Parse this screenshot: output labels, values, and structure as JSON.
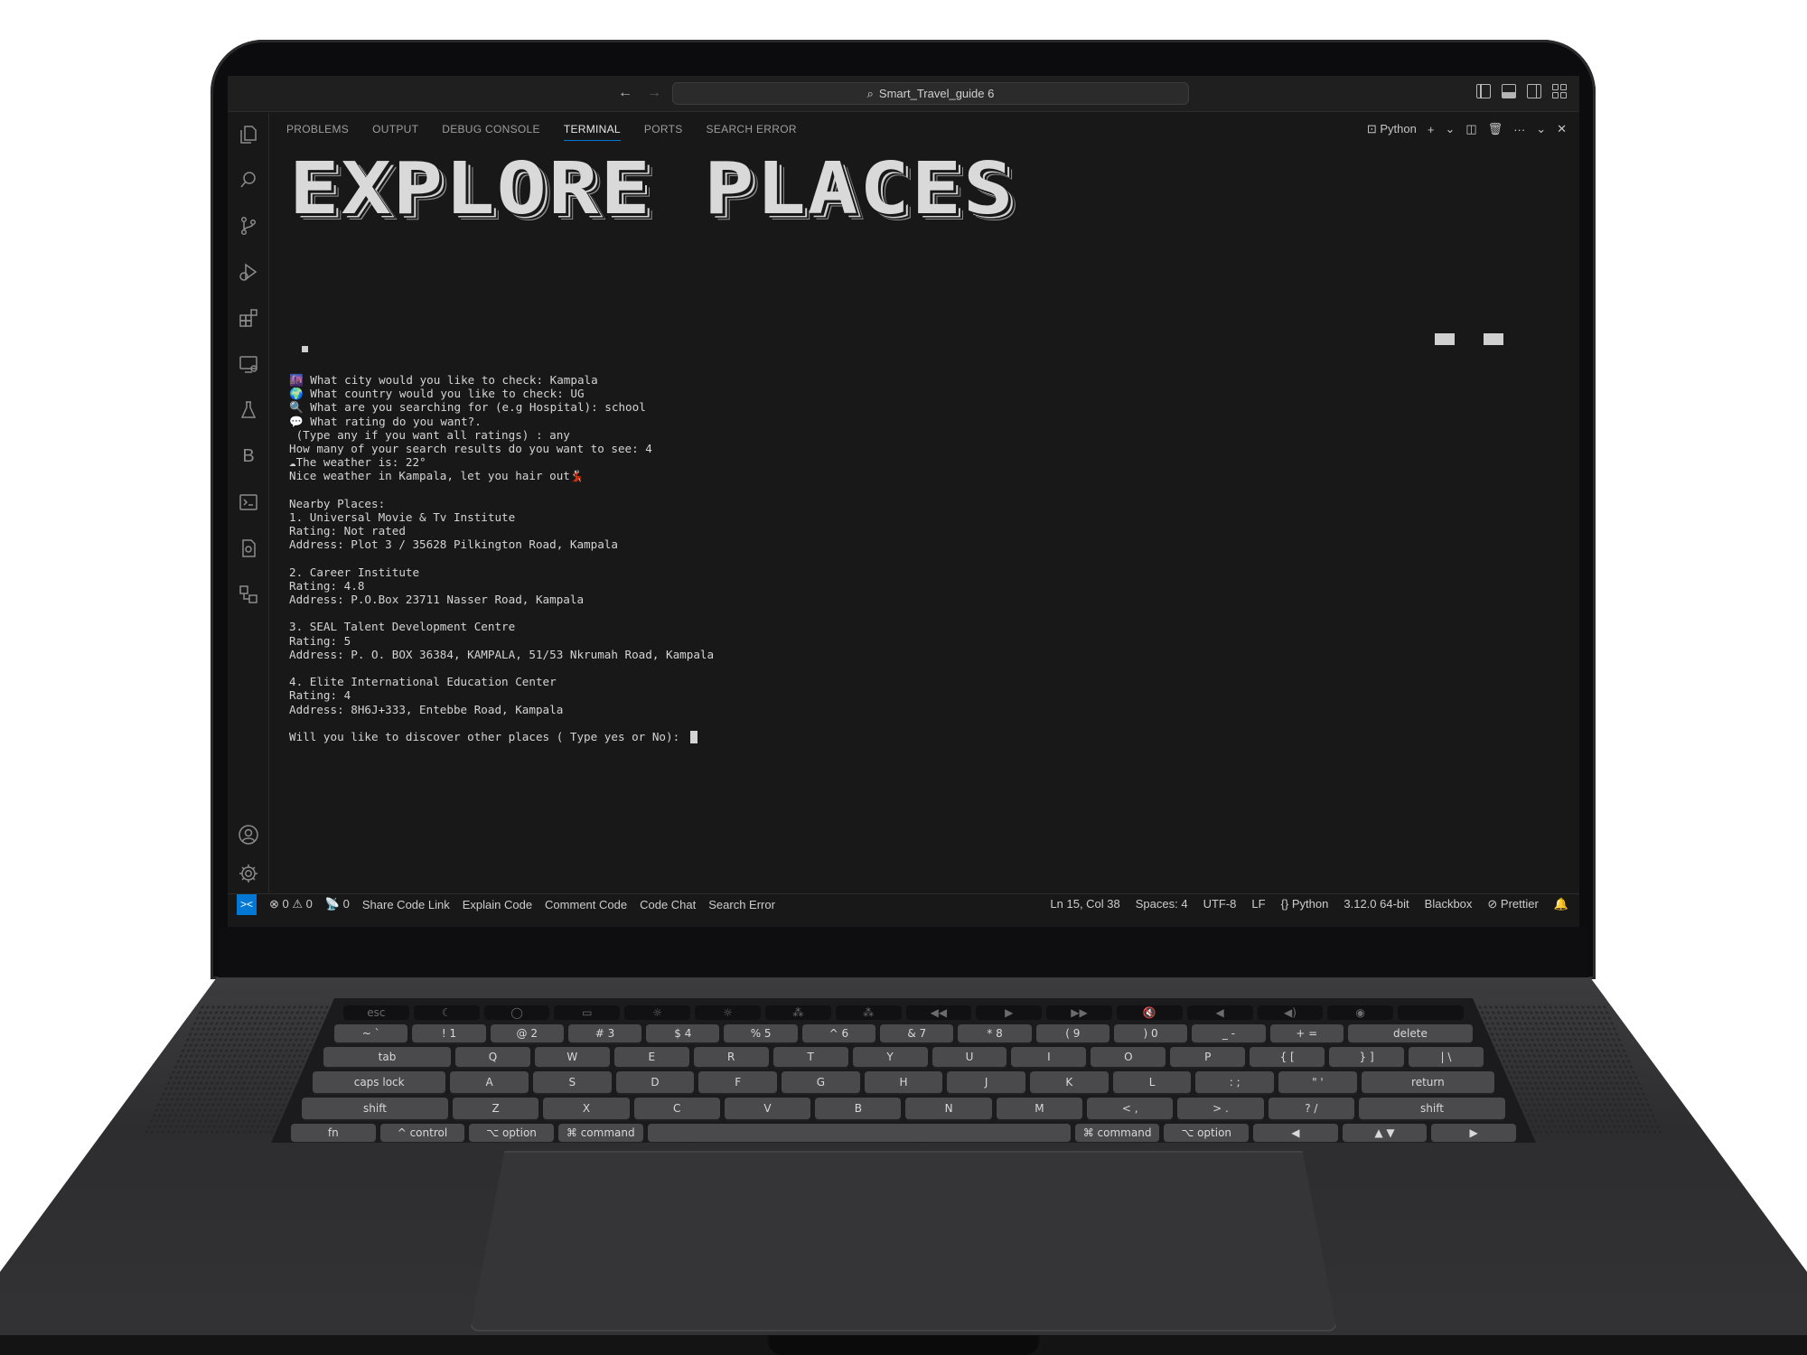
{
  "window": {
    "search_title": "Smart_Travel_guide 6",
    "nav_back": "←",
    "nav_forward": "→"
  },
  "panel_tabs": [
    {
      "label": "PROBLEMS"
    },
    {
      "label": "OUTPUT"
    },
    {
      "label": "DEBUG CONSOLE"
    },
    {
      "label": "TERMINAL",
      "active": true
    },
    {
      "label": "PORTS"
    },
    {
      "label": "SEARCH ERROR"
    }
  ],
  "panel_actions": {
    "shell_label": "Python",
    "add": "+",
    "dropdown": "⌄",
    "more": "···",
    "collapse": "⌄",
    "close": "✕"
  },
  "terminal": {
    "banner": "EXPLORE PLACES",
    "lines": [
      "🌆 What city would you like to check: Kampala",
      "🌍 What country would you like to check: UG",
      "🔍 What are you searching for (e.g Hospital): school",
      "💬 What rating do you want?.",
      " (Type any if you want all ratings) : any",
      "How many of your search results do you want to see: 4",
      "☁The weather is: 22°",
      "Nice weather in Kampala, let you hair out💃🏻",
      "",
      "Nearby Places:",
      "1. Universal Movie & Tv Institute",
      "Rating: Not rated",
      "Address: Plot 3 / 35628 Pilkington Road, Kampala",
      "",
      "2. Career Institute",
      "Rating: 4.8",
      "Address: P.O.Box 23711 Nasser Road, Kampala",
      "",
      "3. SEAL Talent Development Centre",
      "Rating: 5",
      "Address: P. O. BOX 36384, KAMPALA, 51/53 Nkrumah Road, Kampala",
      "",
      "4. Elite International Education Center",
      "Rating: 4",
      "Address: 8H6J+333, Entebbe Road, Kampala",
      ""
    ],
    "prompt": "Will you like to discover other places ( Type yes or No): "
  },
  "statusbar": {
    "remote": "><",
    "errors": "⊗ 0 ⚠ 0",
    "ports": "📡 0",
    "items_left": [
      "Share Code Link",
      "Explain Code",
      "Comment Code",
      "Code Chat",
      "Search Error"
    ],
    "position": "Ln 15, Col 38",
    "spaces": "Spaces: 4",
    "encoding": "UTF-8",
    "eol": "LF",
    "language": "{} Python",
    "interpreter": "3.12.0 64-bit",
    "blackbox": "Blackbox",
    "prettier": "⊘ Prettier",
    "bell": "🔔"
  },
  "keyboard": {
    "touchbar": [
      "esc",
      "☾",
      "◯",
      "▭",
      "☼",
      "☼",
      "⁂",
      "⁂",
      "◀◀",
      "▶",
      "▶▶",
      "🔇",
      "◀",
      "◀)",
      "◉",
      ""
    ],
    "row1": [
      "~ `",
      "! 1",
      "@ 2",
      "# 3",
      "$ 4",
      "% 5",
      "^ 6",
      "& 7",
      "* 8",
      "( 9",
      ") 0",
      "_ -",
      "+ =",
      "delete"
    ],
    "row2": [
      "tab",
      "Q",
      "W",
      "E",
      "R",
      "T",
      "Y",
      "U",
      "I",
      "O",
      "P",
      "{ [",
      "} ]",
      "| \\"
    ],
    "row3": [
      "caps lock",
      "A",
      "S",
      "D",
      "F",
      "G",
      "H",
      "J",
      "K",
      "L",
      ": ;",
      "\" '",
      "return"
    ],
    "row4": [
      "shift",
      "Z",
      "X",
      "C",
      "V",
      "B",
      "N",
      "M",
      "< ,",
      "> .",
      "? /",
      "shift"
    ],
    "row5": [
      "fn",
      "^ control",
      "⌥ option",
      "⌘ command",
      "",
      "⌘ command",
      "⌥ option",
      "◀",
      "▲ ▼",
      "▶"
    ]
  }
}
